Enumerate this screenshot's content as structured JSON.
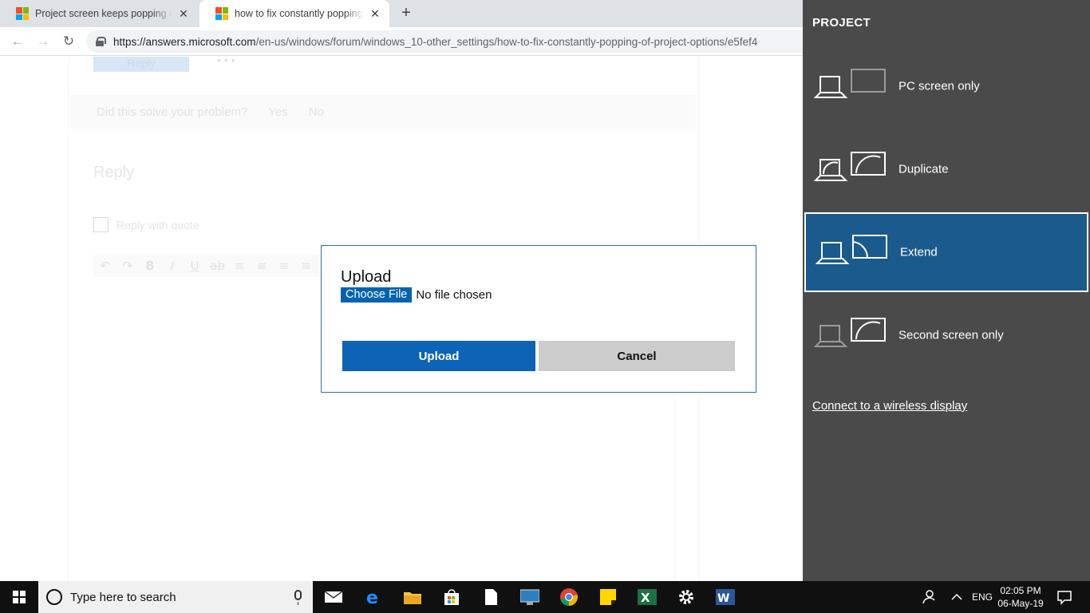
{
  "browser": {
    "tabs": [
      {
        "title": "Project screen keeps popping up",
        "active": false
      },
      {
        "title": "how to fix constantly popping of",
        "active": true
      }
    ],
    "url_host": "https://answers.microsoft.com",
    "url_path": "/en-us/windows/forum/windows_10-other_settings/how-to-fix-constantly-popping-of-project-options/e5fef4"
  },
  "page": {
    "reply_button": "Reply",
    "more": "• • •",
    "solve_question": "Did this solve your problem?",
    "yes": "Yes",
    "no": "No",
    "reply_heading": "Reply",
    "reply_with_quote": "Reply with quote",
    "editor_tools": [
      "undo",
      "redo",
      "bold",
      "italic",
      "underline",
      "strikethrough",
      "align-left",
      "align-center",
      "align-right",
      "justify"
    ]
  },
  "dialog": {
    "title": "Upload",
    "choose_file": "Choose File",
    "no_file": "No file chosen",
    "upload_button": "Upload",
    "cancel_button": "Cancel"
  },
  "project_panel": {
    "title": "PROJECT",
    "options": [
      {
        "label": "PC screen only",
        "selected": false
      },
      {
        "label": "Duplicate",
        "selected": false
      },
      {
        "label": "Extend",
        "selected": true
      },
      {
        "label": "Second screen only",
        "selected": false
      }
    ],
    "wireless_link": "Connect to a wireless display",
    "colors": {
      "panel_bg": "#4a4a4a",
      "selected_bg": "#1b5a8c"
    }
  },
  "taskbar": {
    "search_placeholder": "Type here to search",
    "pinned_apps": [
      "mail-icon",
      "edge-icon",
      "file-explorer-icon",
      "store-icon",
      "file-icon",
      "remote-desktop-icon",
      "chrome-icon",
      "sticky-notes-icon",
      "excel-icon",
      "settings-icon",
      "word-icon"
    ],
    "language": "ENG",
    "time": "02:05 PM",
    "date": "06-May-19"
  }
}
